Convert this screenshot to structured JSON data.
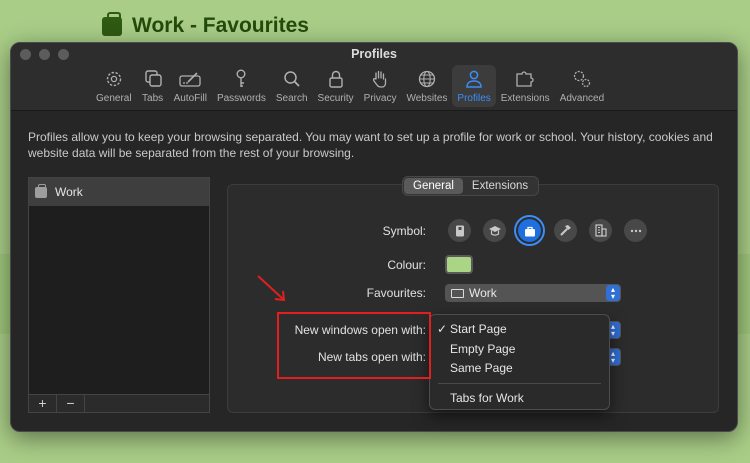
{
  "background": {
    "profile_title": "Work - Favourites",
    "accent_color": "#a9cd87"
  },
  "window": {
    "title": "Profiles"
  },
  "toolbar": {
    "items": [
      {
        "label": "General",
        "icon": "gear-icon"
      },
      {
        "label": "Tabs",
        "icon": "tabs-icon"
      },
      {
        "label": "AutoFill",
        "icon": "pencil-icon"
      },
      {
        "label": "Passwords",
        "icon": "key-icon"
      },
      {
        "label": "Search",
        "icon": "search-icon"
      },
      {
        "label": "Security",
        "icon": "lock-icon"
      },
      {
        "label": "Privacy",
        "icon": "hand-icon"
      },
      {
        "label": "Websites",
        "icon": "globe-icon"
      },
      {
        "label": "Profiles",
        "icon": "person-icon",
        "active": true
      },
      {
        "label": "Extensions",
        "icon": "puzzle-icon"
      },
      {
        "label": "Advanced",
        "icon": "gears-icon"
      }
    ]
  },
  "description": "Profiles allow you to keep your browsing separated. You may want to set up a profile for work or school. Your history, cookies and website data will be separated from the rest of your browsing.",
  "sidebar": {
    "profiles": [
      {
        "name": "Work",
        "icon": "bag-icon"
      }
    ],
    "add_label": "+",
    "remove_label": "−"
  },
  "tabs": {
    "general": "General",
    "extensions": "Extensions",
    "selected": "General"
  },
  "form": {
    "symbol_label": "Symbol:",
    "colour_label": "Colour:",
    "colour_value": "#a9d585",
    "favourites_label": "Favourites:",
    "favourites_value": "Work",
    "new_windows_label": "New windows open with:",
    "new_tabs_label": "New tabs open with:",
    "symbols": [
      "id-badge-icon",
      "graduation-cap-icon",
      "bag-icon",
      "hammer-icon",
      "building-icon",
      "more-icon"
    ],
    "selected_symbol": "bag-icon"
  },
  "dropdown_menu": {
    "options": [
      "Start Page",
      "Empty Page",
      "Same Page"
    ],
    "extra_option": "Tabs for Work",
    "checked": "Start Page",
    "check_mark": "✓"
  }
}
